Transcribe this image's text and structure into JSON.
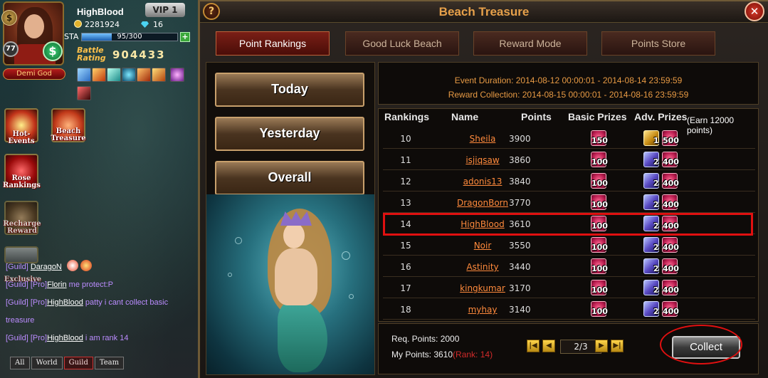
{
  "player": {
    "name": "HighBlood",
    "vip": "VIP 1",
    "level": "77",
    "gold": "2281924",
    "gems": "16",
    "sta_label": "STA",
    "sta_text": "95/300",
    "sta_fraction": 0.317,
    "title": "Demi God",
    "battle_label_1": "Battle",
    "battle_label_2": "Rating",
    "battle_rating": "904433"
  },
  "side_menu": {
    "hot_events_1": "Hot",
    "hot_events_2": "Events",
    "beach_treasure_1": "Beach",
    "beach_treasure_2": "Treasure",
    "rose_rankings_1": "Rose",
    "rose_rankings_2": "Rankings",
    "recharge_reward_1": "Recharge",
    "recharge_reward_2": "Reward",
    "exclusive": "Exclusive"
  },
  "chat": {
    "lines": [
      {
        "channel": "[Guild]",
        "rank": "",
        "name": "DaragoN",
        "msg": ""
      },
      {
        "channel": "[Guild]",
        "rank": "[Pro]",
        "name": "Florin",
        "msg": " me protect:P"
      },
      {
        "channel": "[Guild]",
        "rank": "[Pro]",
        "name": "HighBlood",
        "msg": " patty i cant collect basic"
      },
      {
        "channel": "",
        "rank": "",
        "name": "",
        "msg": "treasure"
      },
      {
        "channel": "[Guild]",
        "rank": "[Pro]",
        "name": "HighBlood",
        "msg": " i am rank 14"
      }
    ],
    "tabs": [
      "All",
      "World",
      "Guild",
      "Team"
    ],
    "active_tab": "Guild"
  },
  "dialog": {
    "title": "Beach Treasure",
    "help": "?",
    "close": "✕",
    "tabs": [
      "Point Rankings",
      "Good Luck Beach",
      "Reward Mode",
      "Points Store"
    ],
    "active_tab": "Point Rankings",
    "period_buttons": [
      "Today",
      "Yesterday",
      "Overall"
    ],
    "event_duration": "Event Duration: 2014-08-12 00:00:01 - 2014-08-14 23:59:59",
    "reward_collection": "Reward Collection: 2014-08-15 00:00:01 - 2014-08-16 23:59:59",
    "headers": {
      "rankings": "Rankings",
      "name": "Name",
      "points": "Points",
      "basic": "Basic Prizes",
      "adv": "Adv. Prizes",
      "note": "(Earn 12000 points)"
    },
    "rows": [
      {
        "rank": "10",
        "name": "Sheila",
        "points": "3900",
        "basic": "150",
        "adv_first_type": "gold",
        "adv_first": "1",
        "adv_second": "500"
      },
      {
        "rank": "11",
        "name": "isjiqsaw",
        "points": "3860",
        "basic": "100",
        "adv_first_type": "rune",
        "adv_first": "2",
        "adv_second": "400"
      },
      {
        "rank": "12",
        "name": "adonis13",
        "points": "3840",
        "basic": "100",
        "adv_first_type": "rune",
        "adv_first": "2",
        "adv_second": "400"
      },
      {
        "rank": "13",
        "name": "DragonBorn",
        "points": "3770",
        "basic": "100",
        "adv_first_type": "rune",
        "adv_first": "2",
        "adv_second": "400"
      },
      {
        "rank": "14",
        "name": "HighBlood",
        "points": "3610",
        "basic": "100",
        "adv_first_type": "rune",
        "adv_first": "2",
        "adv_second": "400"
      },
      {
        "rank": "15",
        "name": "Noir",
        "points": "3550",
        "basic": "100",
        "adv_first_type": "rune",
        "adv_first": "2",
        "adv_second": "400"
      },
      {
        "rank": "16",
        "name": "Astinity",
        "points": "3440",
        "basic": "100",
        "adv_first_type": "rune",
        "adv_first": "2",
        "adv_second": "400"
      },
      {
        "rank": "17",
        "name": "kingkumar",
        "points": "3170",
        "basic": "100",
        "adv_first_type": "rune",
        "adv_first": "2",
        "adv_second": "400"
      },
      {
        "rank": "18",
        "name": "myhay",
        "points": "3140",
        "basic": "100",
        "adv_first_type": "rune",
        "adv_first": "2",
        "adv_second": "400"
      }
    ],
    "req_points": "Req. Points: 2000",
    "my_points": "My Points: 3610",
    "my_rank": "(Rank: 14)",
    "page": "2/3",
    "pager": {
      "first": "|◀",
      "prev": "◀",
      "next": "▶",
      "last": "▶|"
    },
    "collect": "Collect"
  }
}
